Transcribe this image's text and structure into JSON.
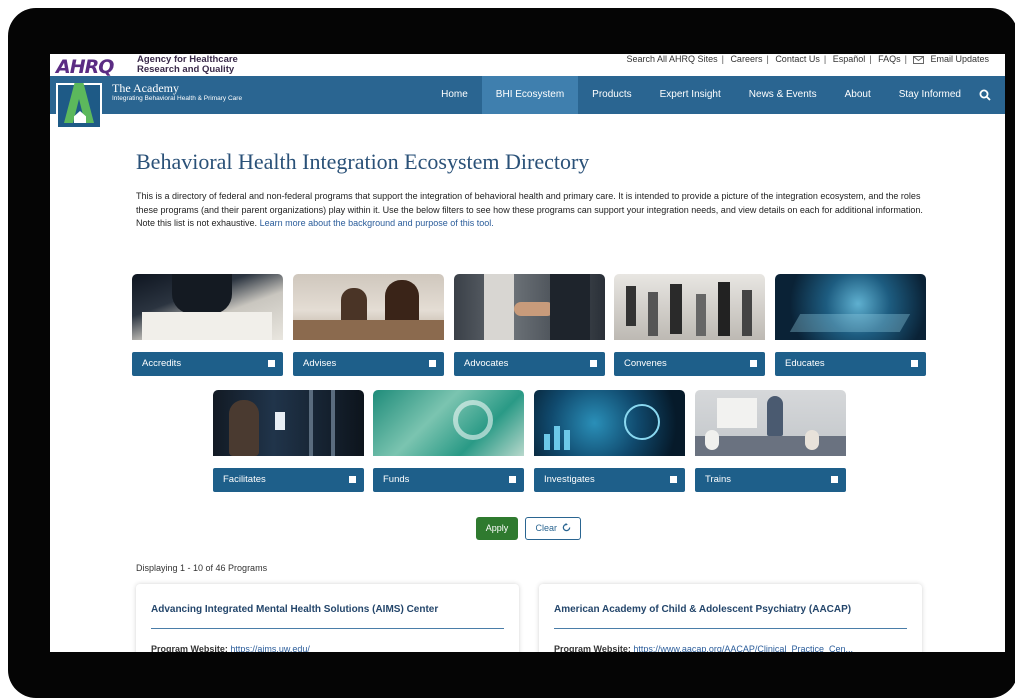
{
  "header": {
    "logo_text": "AHRQ",
    "agency_line1": "Agency for Healthcare",
    "agency_line2": "Research and Quality",
    "util_links": [
      "Search All AHRQ Sites",
      "Careers",
      "Contact Us",
      "Español",
      "FAQs",
      "Email Updates"
    ]
  },
  "nav": {
    "site_title": "The Academy",
    "site_subtitle": "Integrating Behavioral Health & Primary Care",
    "items": [
      "Home",
      "BHI Ecosystem",
      "Products",
      "Expert Insight",
      "News & Events",
      "About",
      "Stay Informed"
    ],
    "active_item": "BHI Ecosystem"
  },
  "page": {
    "title": "Behavioral Health Integration Ecosystem Directory",
    "intro": "This is a directory of federal and non-federal programs that support the integration of behavioral health and primary care. It is intended to provide a picture of the integration ecosystem, and the roles these programs (and their parent organizations) play within it. Use the below filters to see how these programs can support your integration needs, and view details on each for additional information. Note this list is not exhaustive.",
    "learn_more": "Learn more about the background and purpose of this tool."
  },
  "filters": [
    {
      "label": "Accredits",
      "checked": false
    },
    {
      "label": "Advises",
      "checked": false
    },
    {
      "label": "Advocates",
      "checked": false
    },
    {
      "label": "Convenes",
      "checked": false
    },
    {
      "label": "Educates",
      "checked": false
    },
    {
      "label": "Facilitates",
      "checked": false
    },
    {
      "label": "Funds",
      "checked": false
    },
    {
      "label": "Investigates",
      "checked": false
    },
    {
      "label": "Trains",
      "checked": false
    }
  ],
  "actions": {
    "apply": "Apply",
    "clear": "Clear"
  },
  "results": {
    "displaying": "Displaying 1 - 10 of 46 Programs",
    "cards": [
      {
        "title": "Advancing Integrated Mental Health Solutions (AIMS) Center",
        "website_label": "Program Website:",
        "website_url": "https://aims.uw.edu/"
      },
      {
        "title": "American Academy of Child & Adolescent Psychiatry (AACAP)",
        "website_label": "Program Website:",
        "website_url": "https://www.aacap.org/AACAP/Clinical_Practice_Cen..."
      }
    ]
  },
  "colors": {
    "nav_bg": "#2a6591",
    "nav_active": "#3f7fae",
    "filter_bar": "#1e5f8a",
    "apply_green": "#2f7a2f",
    "title_blue": "#2a5178"
  }
}
